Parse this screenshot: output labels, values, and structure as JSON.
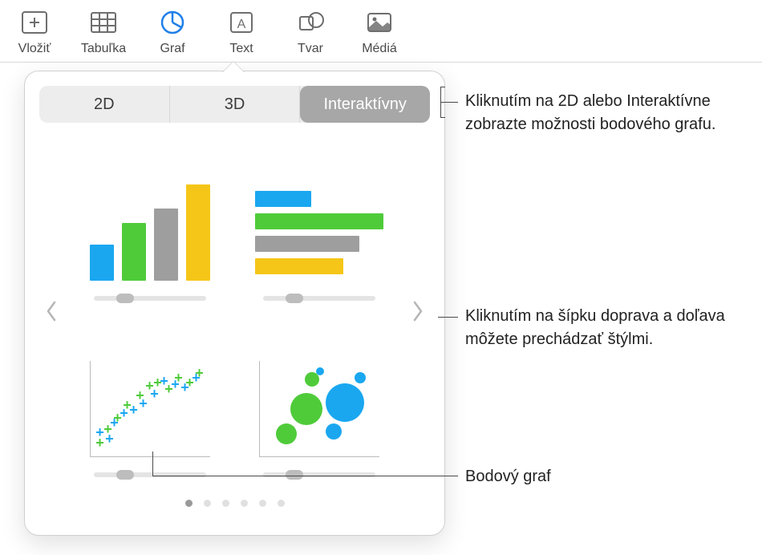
{
  "toolbar": {
    "items": [
      {
        "label": "Vložiť",
        "icon": "insert"
      },
      {
        "label": "Tabuľka",
        "icon": "table"
      },
      {
        "label": "Graf",
        "icon": "chart",
        "active": true
      },
      {
        "label": "Text",
        "icon": "text"
      },
      {
        "label": "Tvar",
        "icon": "shape"
      },
      {
        "label": "Médiá",
        "icon": "media"
      }
    ]
  },
  "popover": {
    "tabs": {
      "tab_2d": "2D",
      "tab_3d": "3D",
      "tab_interactive": "Interaktívny",
      "selected": "Interaktívny"
    },
    "charts": [
      {
        "type": "column",
        "name": "column-chart"
      },
      {
        "type": "bar",
        "name": "bar-chart"
      },
      {
        "type": "scatter",
        "name": "scatter-chart"
      },
      {
        "type": "bubble",
        "name": "bubble-chart"
      }
    ],
    "page_count": 6,
    "active_page": 0
  },
  "callouts": {
    "c1": "Kliknutím na 2D alebo Interaktívne zobrazte možnosti bodového grafu.",
    "c2": "Kliknutím na šípku doprava a doľava môžete prechádzať štýlmi.",
    "c3": "Bodový graf"
  }
}
